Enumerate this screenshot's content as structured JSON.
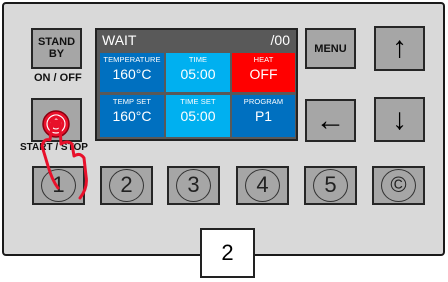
{
  "panel": {
    "standby_line1": "STAND",
    "standby_line2": "BY",
    "on_off_label": "ON / OFF",
    "start_stop_label": "START / STOP",
    "menu_label": "MENU"
  },
  "display": {
    "status": "WAIT",
    "counter": "/00",
    "cells": [
      {
        "caption": "TEMPERATURE",
        "value": "160°C",
        "color": "#0070c0"
      },
      {
        "caption": "TIME",
        "value": "05:00",
        "color": "#00b0f0"
      },
      {
        "caption": "HEAT",
        "value": "OFF",
        "color": "#ff0000"
      },
      {
        "caption": "TEMP SET",
        "value": "160°C",
        "color": "#0070c0"
      },
      {
        "caption": "TIME SET",
        "value": "05:00",
        "color": "#00b0f0"
      },
      {
        "caption": "PROGRAM",
        "value": "P1",
        "color": "#0070c0"
      }
    ]
  },
  "arrows": {
    "up": "↑",
    "down": "↓",
    "left": "←"
  },
  "number_buttons": [
    "1",
    "2",
    "3",
    "4",
    "5",
    "©"
  ],
  "callout": {
    "text": "2"
  },
  "icons": [
    "hand-pointer-icon",
    "up-arrow-icon",
    "down-arrow-icon",
    "left-arrow-icon"
  ]
}
